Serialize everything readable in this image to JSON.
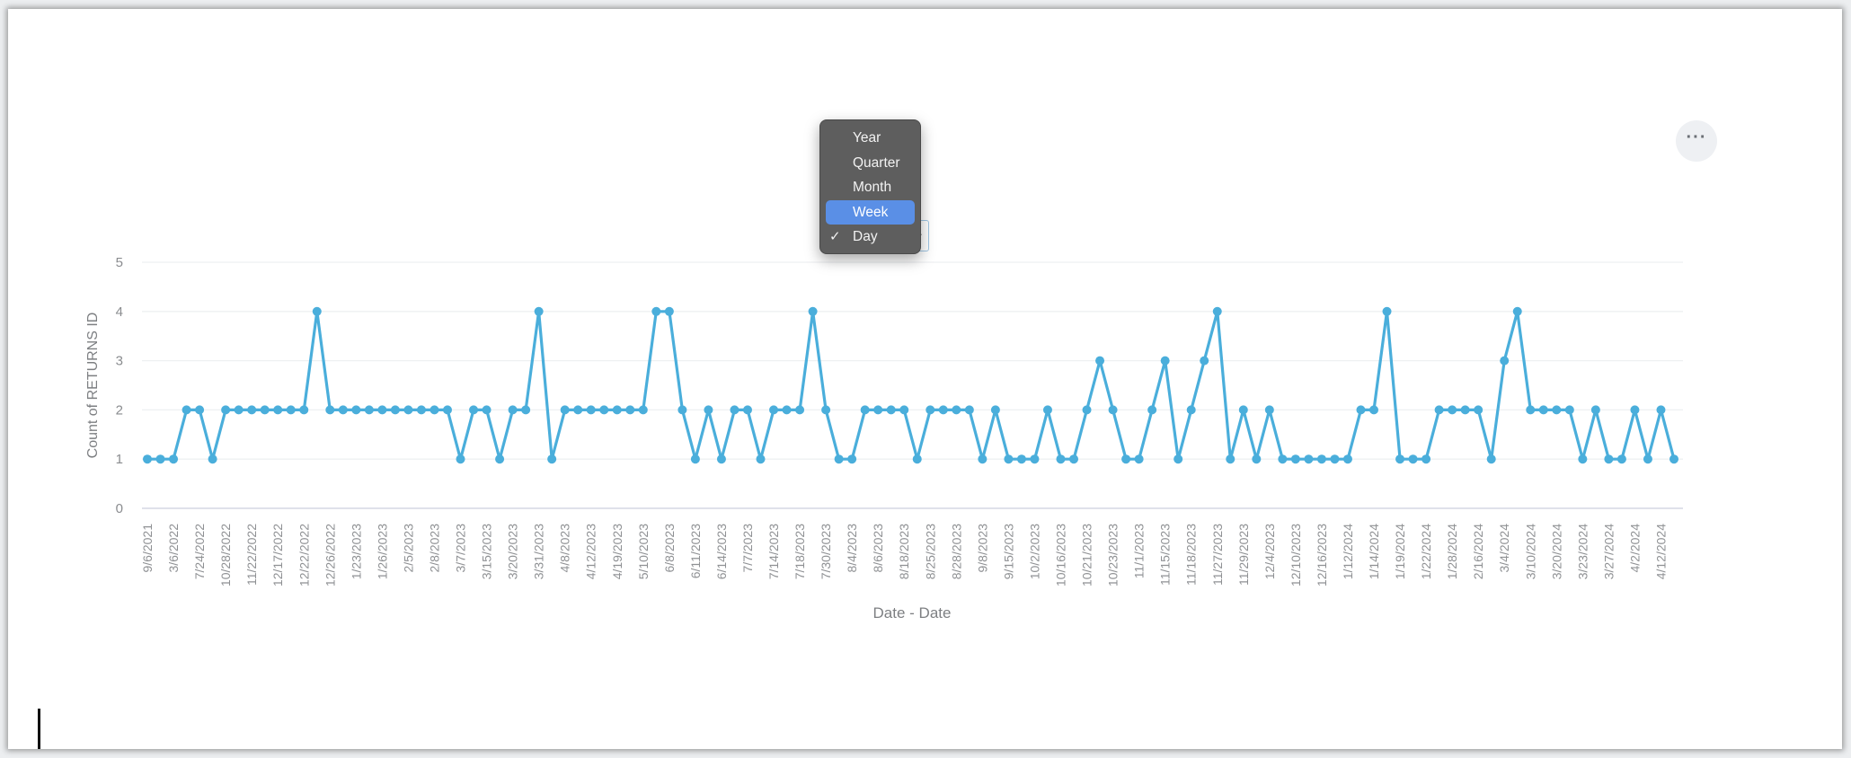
{
  "more_button": {
    "icon": "ellipsis-icon",
    "label": "···"
  },
  "granularity_menu": {
    "items": [
      {
        "label": "Year",
        "checked": false,
        "highlighted": false
      },
      {
        "label": "Quarter",
        "checked": false,
        "highlighted": false
      },
      {
        "label": "Month",
        "checked": false,
        "highlighted": false
      },
      {
        "label": "Week",
        "checked": false,
        "highlighted": true
      },
      {
        "label": "Day",
        "checked": true,
        "highlighted": false
      }
    ],
    "check_glyph": "✓",
    "highlight_color": "#5a8fe6"
  },
  "chart_data": {
    "type": "line",
    "title": "",
    "xlabel": "Date - Date",
    "ylabel": "Count of RETURNS ID",
    "ylim": [
      0,
      5
    ],
    "yticks": [
      0,
      1,
      2,
      3,
      4,
      5
    ],
    "grid": true,
    "legend": "none",
    "line_color": "#4aaedb",
    "tick_labels_every": 2,
    "x_tick_labels": [
      "9/6/2021",
      "3/6/2022",
      "7/24/2022",
      "10/28/2022",
      "11/22/2022",
      "12/17/2022",
      "12/22/2022",
      "12/26/2022",
      "1/23/2023",
      "1/26/2023",
      "2/5/2023",
      "2/8/2023",
      "3/7/2023",
      "3/15/2023",
      "3/20/2023",
      "3/31/2023",
      "4/8/2023",
      "4/12/2023",
      "4/19/2023",
      "5/10/2023",
      "6/8/2023",
      "6/11/2023",
      "6/14/2023",
      "7/7/2023",
      "7/14/2023",
      "7/18/2023",
      "7/30/2023",
      "8/4/2023",
      "8/6/2023",
      "8/18/2023",
      "8/25/2023",
      "8/28/2023",
      "9/8/2023",
      "9/15/2023",
      "10/2/2023",
      "10/16/2023",
      "10/21/2023",
      "10/23/2023",
      "11/1/2023",
      "11/15/2023",
      "11/18/2023",
      "11/27/2023",
      "11/29/2023",
      "12/4/2023",
      "12/10/2023",
      "12/16/2023",
      "1/12/2024",
      "1/14/2024",
      "1/19/2024",
      "1/22/2024",
      "1/28/2024",
      "2/16/2024",
      "3/4/2024",
      "3/10/2024",
      "3/20/2024",
      "3/23/2024",
      "3/27/2024",
      "4/2/2024",
      "4/12/2024"
    ],
    "series": [
      {
        "name": "Count of RETURNS ID",
        "values": [
          1,
          1,
          1,
          2,
          2,
          1,
          2,
          2,
          2,
          2,
          2,
          2,
          2,
          4,
          2,
          2,
          2,
          2,
          2,
          2,
          2,
          2,
          2,
          2,
          1,
          2,
          2,
          1,
          2,
          2,
          4,
          1,
          2,
          2,
          2,
          2,
          2,
          2,
          2,
          4,
          4,
          2,
          1,
          2,
          1,
          2,
          2,
          1,
          2,
          2,
          2,
          4,
          2,
          1,
          1,
          2,
          2,
          2,
          2,
          1,
          2,
          2,
          2,
          2,
          1,
          2,
          1,
          1,
          1,
          2,
          1,
          1,
          2,
          3,
          2,
          1,
          1,
          2,
          3,
          1,
          2,
          3,
          4,
          1,
          2,
          1,
          2,
          1,
          1,
          1,
          1,
          1,
          1,
          2,
          2,
          4,
          1,
          1,
          1,
          2,
          2,
          2,
          2,
          1,
          3,
          4,
          2,
          2,
          2,
          2,
          1,
          2,
          1,
          1,
          2,
          1,
          2,
          1
        ]
      }
    ]
  }
}
